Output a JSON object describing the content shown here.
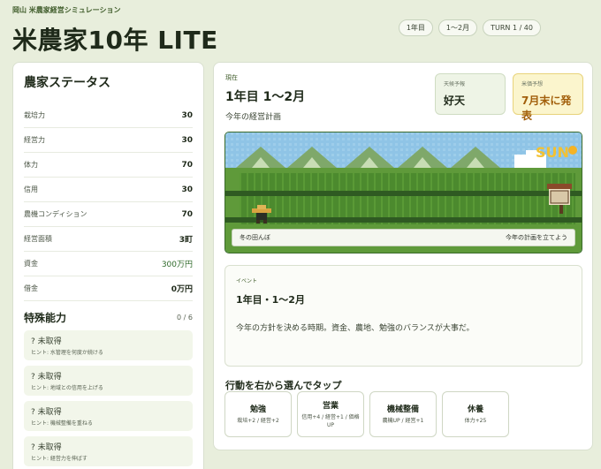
{
  "header": {
    "subtitle": "岡山 米農家経営シミュレーション",
    "title": "米農家10年 LITE",
    "pills": [
      "1年目",
      "1〜2月",
      "TURN 1 / 40"
    ]
  },
  "status": {
    "title": "農家ステータス",
    "stats": [
      {
        "label": "栽培力",
        "value": "30"
      },
      {
        "label": "経営力",
        "value": "30"
      },
      {
        "label": "体力",
        "value": "70"
      },
      {
        "label": "信用",
        "value": "30"
      },
      {
        "label": "農機コンディション",
        "value": "70"
      },
      {
        "label": "経営面積",
        "value": "3町"
      },
      {
        "label": "資金",
        "value": "300万円"
      },
      {
        "label": "借金",
        "value": "0万円"
      }
    ],
    "special_title": "特殊能力",
    "special_count": "0 / 6",
    "abilities": [
      {
        "name": "? 未取得",
        "hint": "ヒント: 水管理を何度か続ける"
      },
      {
        "name": "? 未取得",
        "hint": "ヒント: 地域との信用を上げる"
      },
      {
        "name": "? 未取得",
        "hint": "ヒント: 機械整備を重ねる"
      },
      {
        "name": "? 未取得",
        "hint": "ヒント: 経営力を伸ばす"
      }
    ]
  },
  "main": {
    "now_label": "現在",
    "now_date": "1年目 1〜2月",
    "now_plan": "今年の経営計画",
    "weather_label": "天候予報",
    "weather_value": "好天",
    "price_label": "米価予想",
    "price_value": "7月末に発表",
    "scene_sun": "SUN",
    "scene_left": "冬の田んぼ",
    "scene_right": "今年の計画を立てよう",
    "event_label": "イベント",
    "event_title": "1年目・1〜2月",
    "event_text": "今年の方針を決める時期。資金、農地、勉強のバランスが大事だ。",
    "action_title": "行動を右から選んでタップ",
    "actions": [
      {
        "name": "勉強",
        "effect": "栽培+2 / 経営+2"
      },
      {
        "name": "営業",
        "effect": "信用+4 / 経営+1 / 価格UP"
      },
      {
        "name": "機械整備",
        "effect": "農機UP / 経営+1"
      },
      {
        "name": "休養",
        "effect": "体力+25"
      }
    ]
  },
  "colors": {
    "background": "#e8eedc",
    "accent_green": "#3f5c2a",
    "money_green": "#2f6a2a",
    "price_orange": "#a25f0b"
  }
}
